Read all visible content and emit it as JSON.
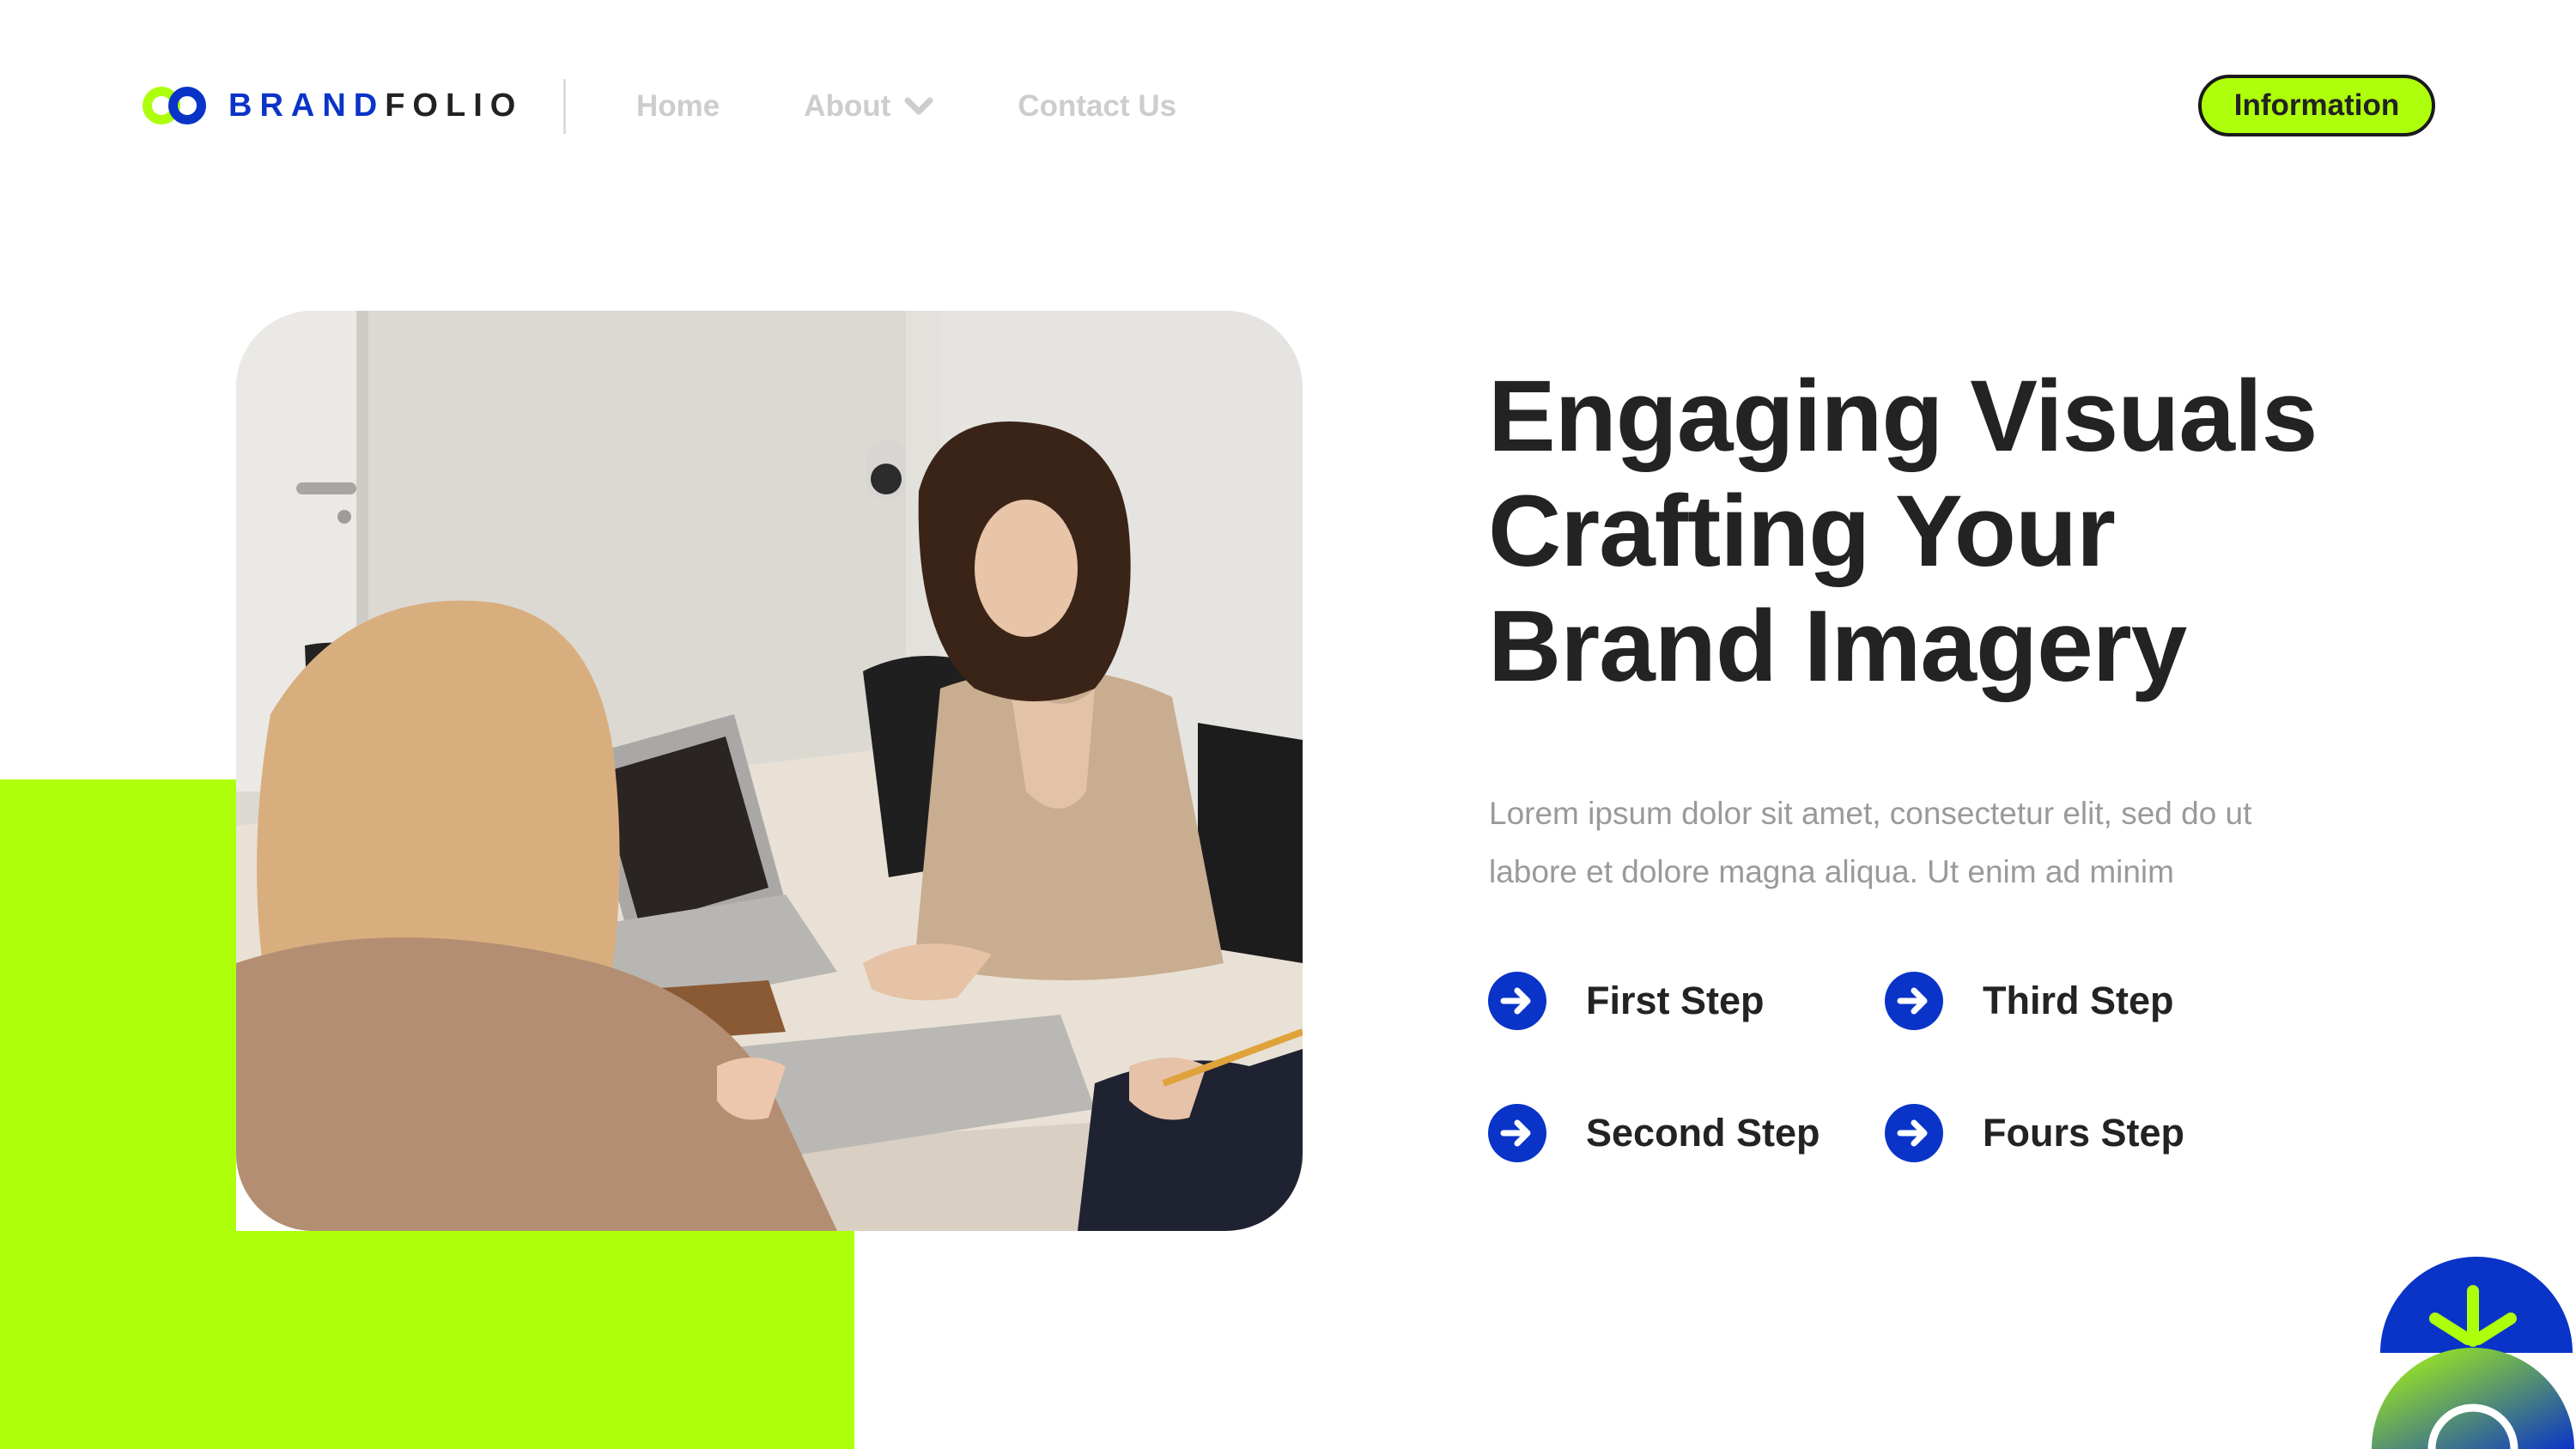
{
  "brand": {
    "name_part1": "BRAND",
    "name_part2": "FOLIO"
  },
  "nav": {
    "home": "Home",
    "about": "About",
    "contact": "Contact Us"
  },
  "header": {
    "cta_label": "Information"
  },
  "hero": {
    "title_lines": [
      "Engaging Visuals",
      "Crafting Your",
      "Brand Imagery"
    ],
    "body_lines": [
      "Lorem ipsum dolor sit amet, consectetur elit, sed do ut",
      "labore et dolore magna aliqua. Ut enim ad minim"
    ]
  },
  "steps": [
    "First Step",
    "Third Step",
    "Second Step",
    "Fours Step"
  ],
  "colors": {
    "accent_lime": "#aeff0b",
    "brand_blue": "#0a34c8",
    "text_dark": "#232323",
    "text_muted": "#9a9a9a",
    "nav_muted": "#cdcdcd"
  },
  "icons": {
    "logo": "two-rings-logo-icon",
    "about": "chevron-down-icon",
    "step": "arrow-right-circle-icon",
    "decoration": "sun-burst-icon"
  }
}
